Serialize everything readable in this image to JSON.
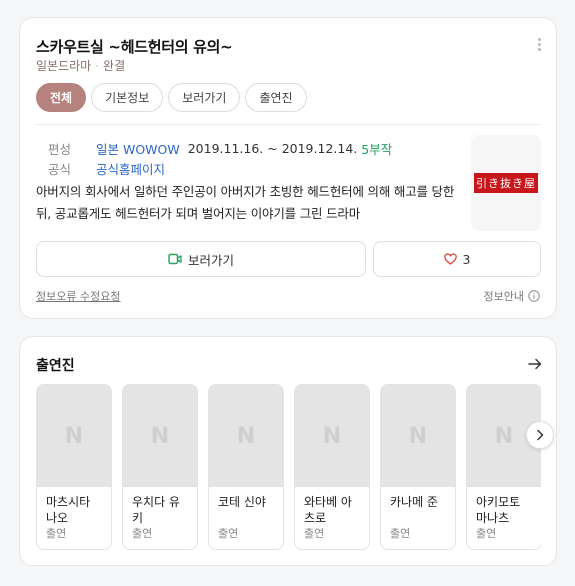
{
  "header": {
    "title": "스카우트실 ~헤드헌터의 유의~",
    "genre": "일본드라마",
    "status": "완결"
  },
  "tabs": [
    {
      "label": "전체",
      "active": true
    },
    {
      "label": "기본정보",
      "active": false
    },
    {
      "label": "보러가기",
      "active": false
    },
    {
      "label": "출연진",
      "active": false
    }
  ],
  "info": {
    "broadcast_label": "편성",
    "network": "일본 WOWOW",
    "dates": "2019.11.16. ~ 2019.12.14.",
    "episodes": "5부작",
    "official_label": "공식",
    "official_link": "공식홈페이지"
  },
  "description": "아버지의 회사에서 일하던 주인공이 아버지가 초빙한 헤드헌터에 의해 해고를 당한 뒤, 공교롭게도 헤드헌터가 되며 벌어지는 이야기를 그린 드라마",
  "poster": {
    "text": "引き抜き屋"
  },
  "actions": {
    "watch_label": "보러가기",
    "like_count": "3"
  },
  "footer": {
    "report_label": "정보오류 수정요청",
    "guide_label": "정보안내"
  },
  "cast_section": {
    "title": "출연진",
    "placeholder_letter": "N",
    "members": [
      {
        "name": "마츠시타 나오",
        "role": "출연"
      },
      {
        "name": "우치다 유키",
        "role": "출연"
      },
      {
        "name": "코테 신야",
        "role": "출연"
      },
      {
        "name": "와타베 아츠로",
        "role": "출연"
      },
      {
        "name": "카나메 준",
        "role": "출연"
      },
      {
        "name": "아키모토 마나츠",
        "role": "출연"
      }
    ]
  },
  "colors": {
    "accent": "#b5827d",
    "link": "#2c67c6",
    "episodes": "#20a35a",
    "watch_icon": "#20a35a",
    "heart_icon": "#e0443c"
  },
  "icons": [
    "more-vertical-icon",
    "play-icon",
    "heart-icon",
    "info-icon",
    "arrow-right-icon",
    "chevron-right-icon"
  ]
}
